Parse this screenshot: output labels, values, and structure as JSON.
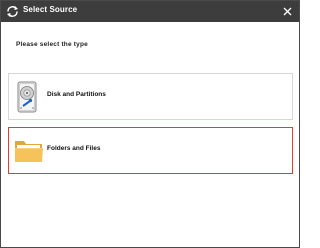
{
  "window": {
    "title": "Select Source",
    "title_icon": "backup-arrows-icon",
    "close_icon": "close-icon"
  },
  "prompt": "Please select the type",
  "options": [
    {
      "label": "Disk and Partitions",
      "icon": "hard-disk-icon",
      "selected": false
    },
    {
      "label": "Folders and Files",
      "icon": "folder-icon",
      "selected": true
    }
  ],
  "colors": {
    "titlebar": "#3d3d3d",
    "selected_border": "#e53935",
    "folder": "#f5c35a"
  }
}
